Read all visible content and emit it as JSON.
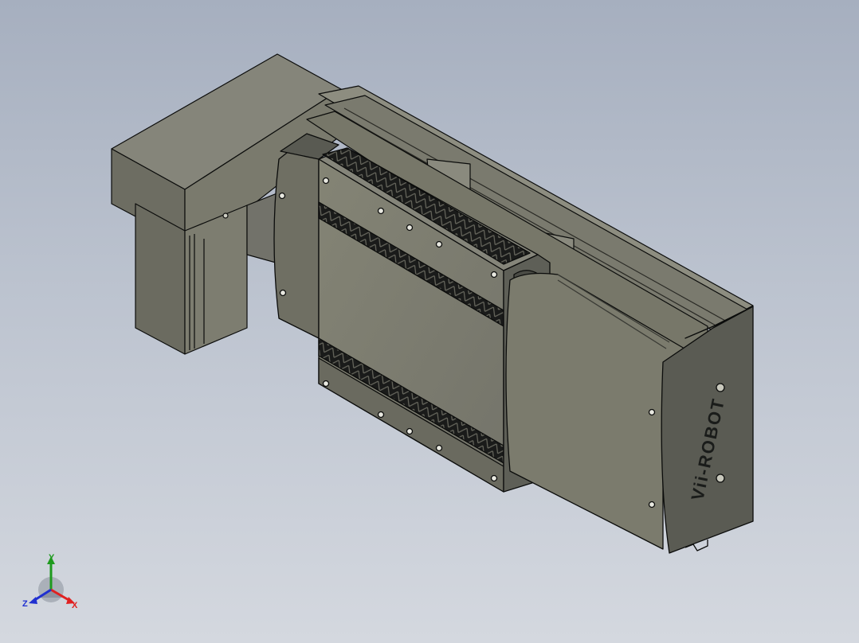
{
  "model": {
    "brand_logo": "Vii-ROBOT",
    "colors": {
      "background_top": "#a6afbf",
      "background_bottom": "#d4d8df",
      "body_face": "#7b7b6c",
      "body_dark": "#4f504a",
      "body_light": "#8d8d7d",
      "slot_dark": "#1c1d1c",
      "edge": "#0b0c0b"
    }
  },
  "triad": {
    "x_label": "X",
    "y_label": "Y",
    "z_label": "Z",
    "x_color": "#e02020",
    "y_color": "#1e9a1e",
    "z_color": "#2030d0"
  }
}
